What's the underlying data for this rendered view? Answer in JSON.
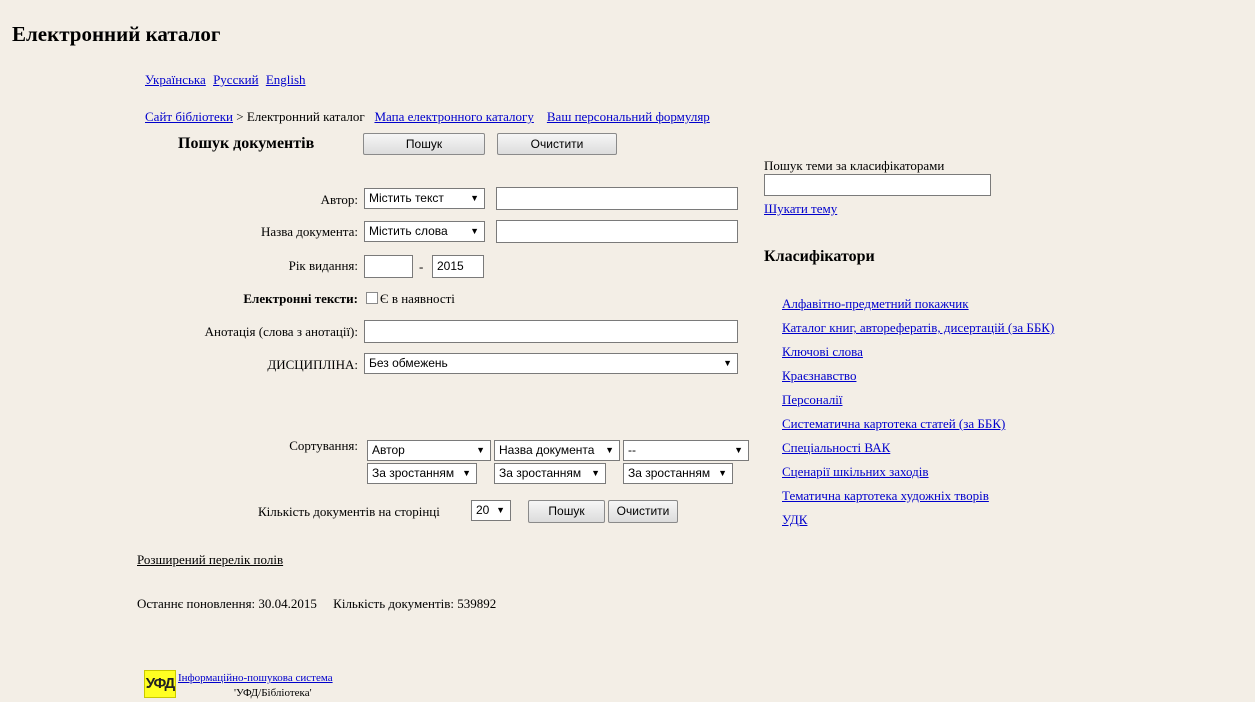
{
  "header": {
    "title": "Електронний каталог"
  },
  "languages": [
    "Українська",
    "Русский",
    "English"
  ],
  "breadcrumb": {
    "site": "Сайт бібліотеки",
    "separator": ">",
    "current": "Електронний каталог",
    "map_link": "Мапа електронного каталогу",
    "formular_link": "Ваш персональний формуляр"
  },
  "search": {
    "heading": "Пошук документів",
    "search_button": "Пошук",
    "clear_button": "Очистити",
    "author": {
      "label": "Автор:",
      "mode": "Містить текст",
      "value": ""
    },
    "title_field": {
      "label": "Назва документа:",
      "mode": "Містить слова",
      "value": ""
    },
    "year": {
      "label": "Рік видання:",
      "from": "",
      "dash": "-",
      "to": "2015"
    },
    "etexts": {
      "label": "Електронні тексти:",
      "option": "Є в наявності",
      "checked": false
    },
    "annotation": {
      "label": "Анотація (слова з анотації):",
      "value": ""
    },
    "discipline": {
      "label": "ДИСЦИПЛІНА:",
      "value": "Без обмежень"
    },
    "sorting": {
      "label": "Сортування:",
      "fields": [
        "Автор",
        "Назва документа",
        "--"
      ],
      "orders": [
        "За зростанням",
        "За зростанням",
        "За зростанням"
      ]
    },
    "per_page": {
      "label": "Кількість документів на сторінці",
      "value": "20"
    },
    "search_button_2": "Пошук",
    "clear_button_2": "Очистити"
  },
  "extended_fields_link": "Розширений перелік полів",
  "status": {
    "last_update_label": "Останнє поновлення:",
    "last_update": "30.04.2015",
    "doc_count_label": "Кількість документів:",
    "doc_count": "539892"
  },
  "topic_search": {
    "label": "Пошук теми за класифікаторами",
    "value": "",
    "button": "Шукати тему"
  },
  "classifiers": {
    "heading": "Класифікатори",
    "items": [
      "Алфавітно-предметний покажчик",
      "Каталог книг, авторефератів, дисертацій (за ББК)",
      "Ключові слова",
      "Краєзнавство",
      "Персоналії",
      "Систематична картотека статей (за ББК)",
      "Спеціальності ВАК",
      "Сценарії шкільних заходів",
      "Тематична картотека художніх творів",
      "УДК"
    ]
  },
  "footer": {
    "logo_text": "УФД",
    "system_link": "Інформаційно-пошукова система",
    "system_name": "'УФД/Бібліотека'"
  },
  "colors": {
    "background": "#f3eee6",
    "link": "#0000cc",
    "logo_bg": "#ffff22"
  }
}
